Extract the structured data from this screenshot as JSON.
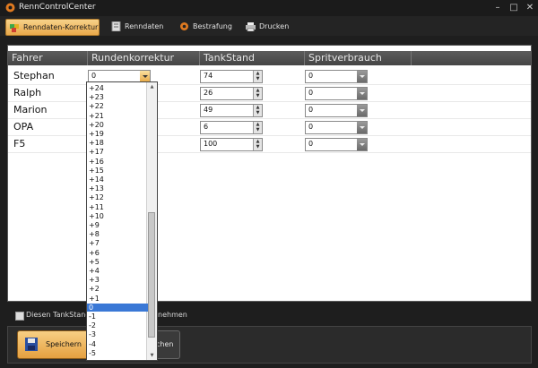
{
  "window": {
    "title": "RennControlCenter"
  },
  "toolbar": [
    {
      "label": "Renndaten-Korrektur",
      "icon": "puzzle-icon",
      "active": true
    },
    {
      "label": "Renndaten",
      "icon": "document-icon"
    },
    {
      "label": "Bestrafung",
      "icon": "gear-icon"
    },
    {
      "label": "Drucken",
      "icon": "printer-icon"
    }
  ],
  "grid": {
    "columns": [
      "Fahrer",
      "Rundenkorrektur",
      "TankStand",
      "Spritverbrauch"
    ],
    "rows": [
      {
        "name": "Stephan",
        "korrektur": "0",
        "tank": "74",
        "sprit": "0"
      },
      {
        "name": "Ralph",
        "korrektur": "",
        "tank": "26",
        "sprit": "0"
      },
      {
        "name": "Marion",
        "korrektur": "",
        "tank": "49",
        "sprit": "0"
      },
      {
        "name": "OPA",
        "korrektur": "",
        "tank": "6",
        "sprit": "0"
      },
      {
        "name": "F5",
        "korrektur": "",
        "tank": "100",
        "sprit": "0"
      }
    ]
  },
  "dropdown": {
    "options": [
      "+24",
      "+23",
      "+22",
      "+21",
      "+20",
      "+19",
      "+18",
      "+17",
      "+16",
      "+15",
      "+14",
      "+13",
      "+12",
      "+11",
      "+10",
      "+9",
      "+8",
      "+7",
      "+6",
      "+5",
      "+4",
      "+3",
      "+2",
      "+1",
      "0",
      "-1",
      "-2",
      "-3",
      "-4",
      "-5"
    ],
    "selected": "0"
  },
  "checkbox": {
    "label_left": "Diesen TankStand",
    "label_right": "nehmen"
  },
  "buttons": {
    "save": "Speichern",
    "second": "chen"
  },
  "colors": {
    "accent": "#e9a84a",
    "selection": "#3a78d6"
  }
}
